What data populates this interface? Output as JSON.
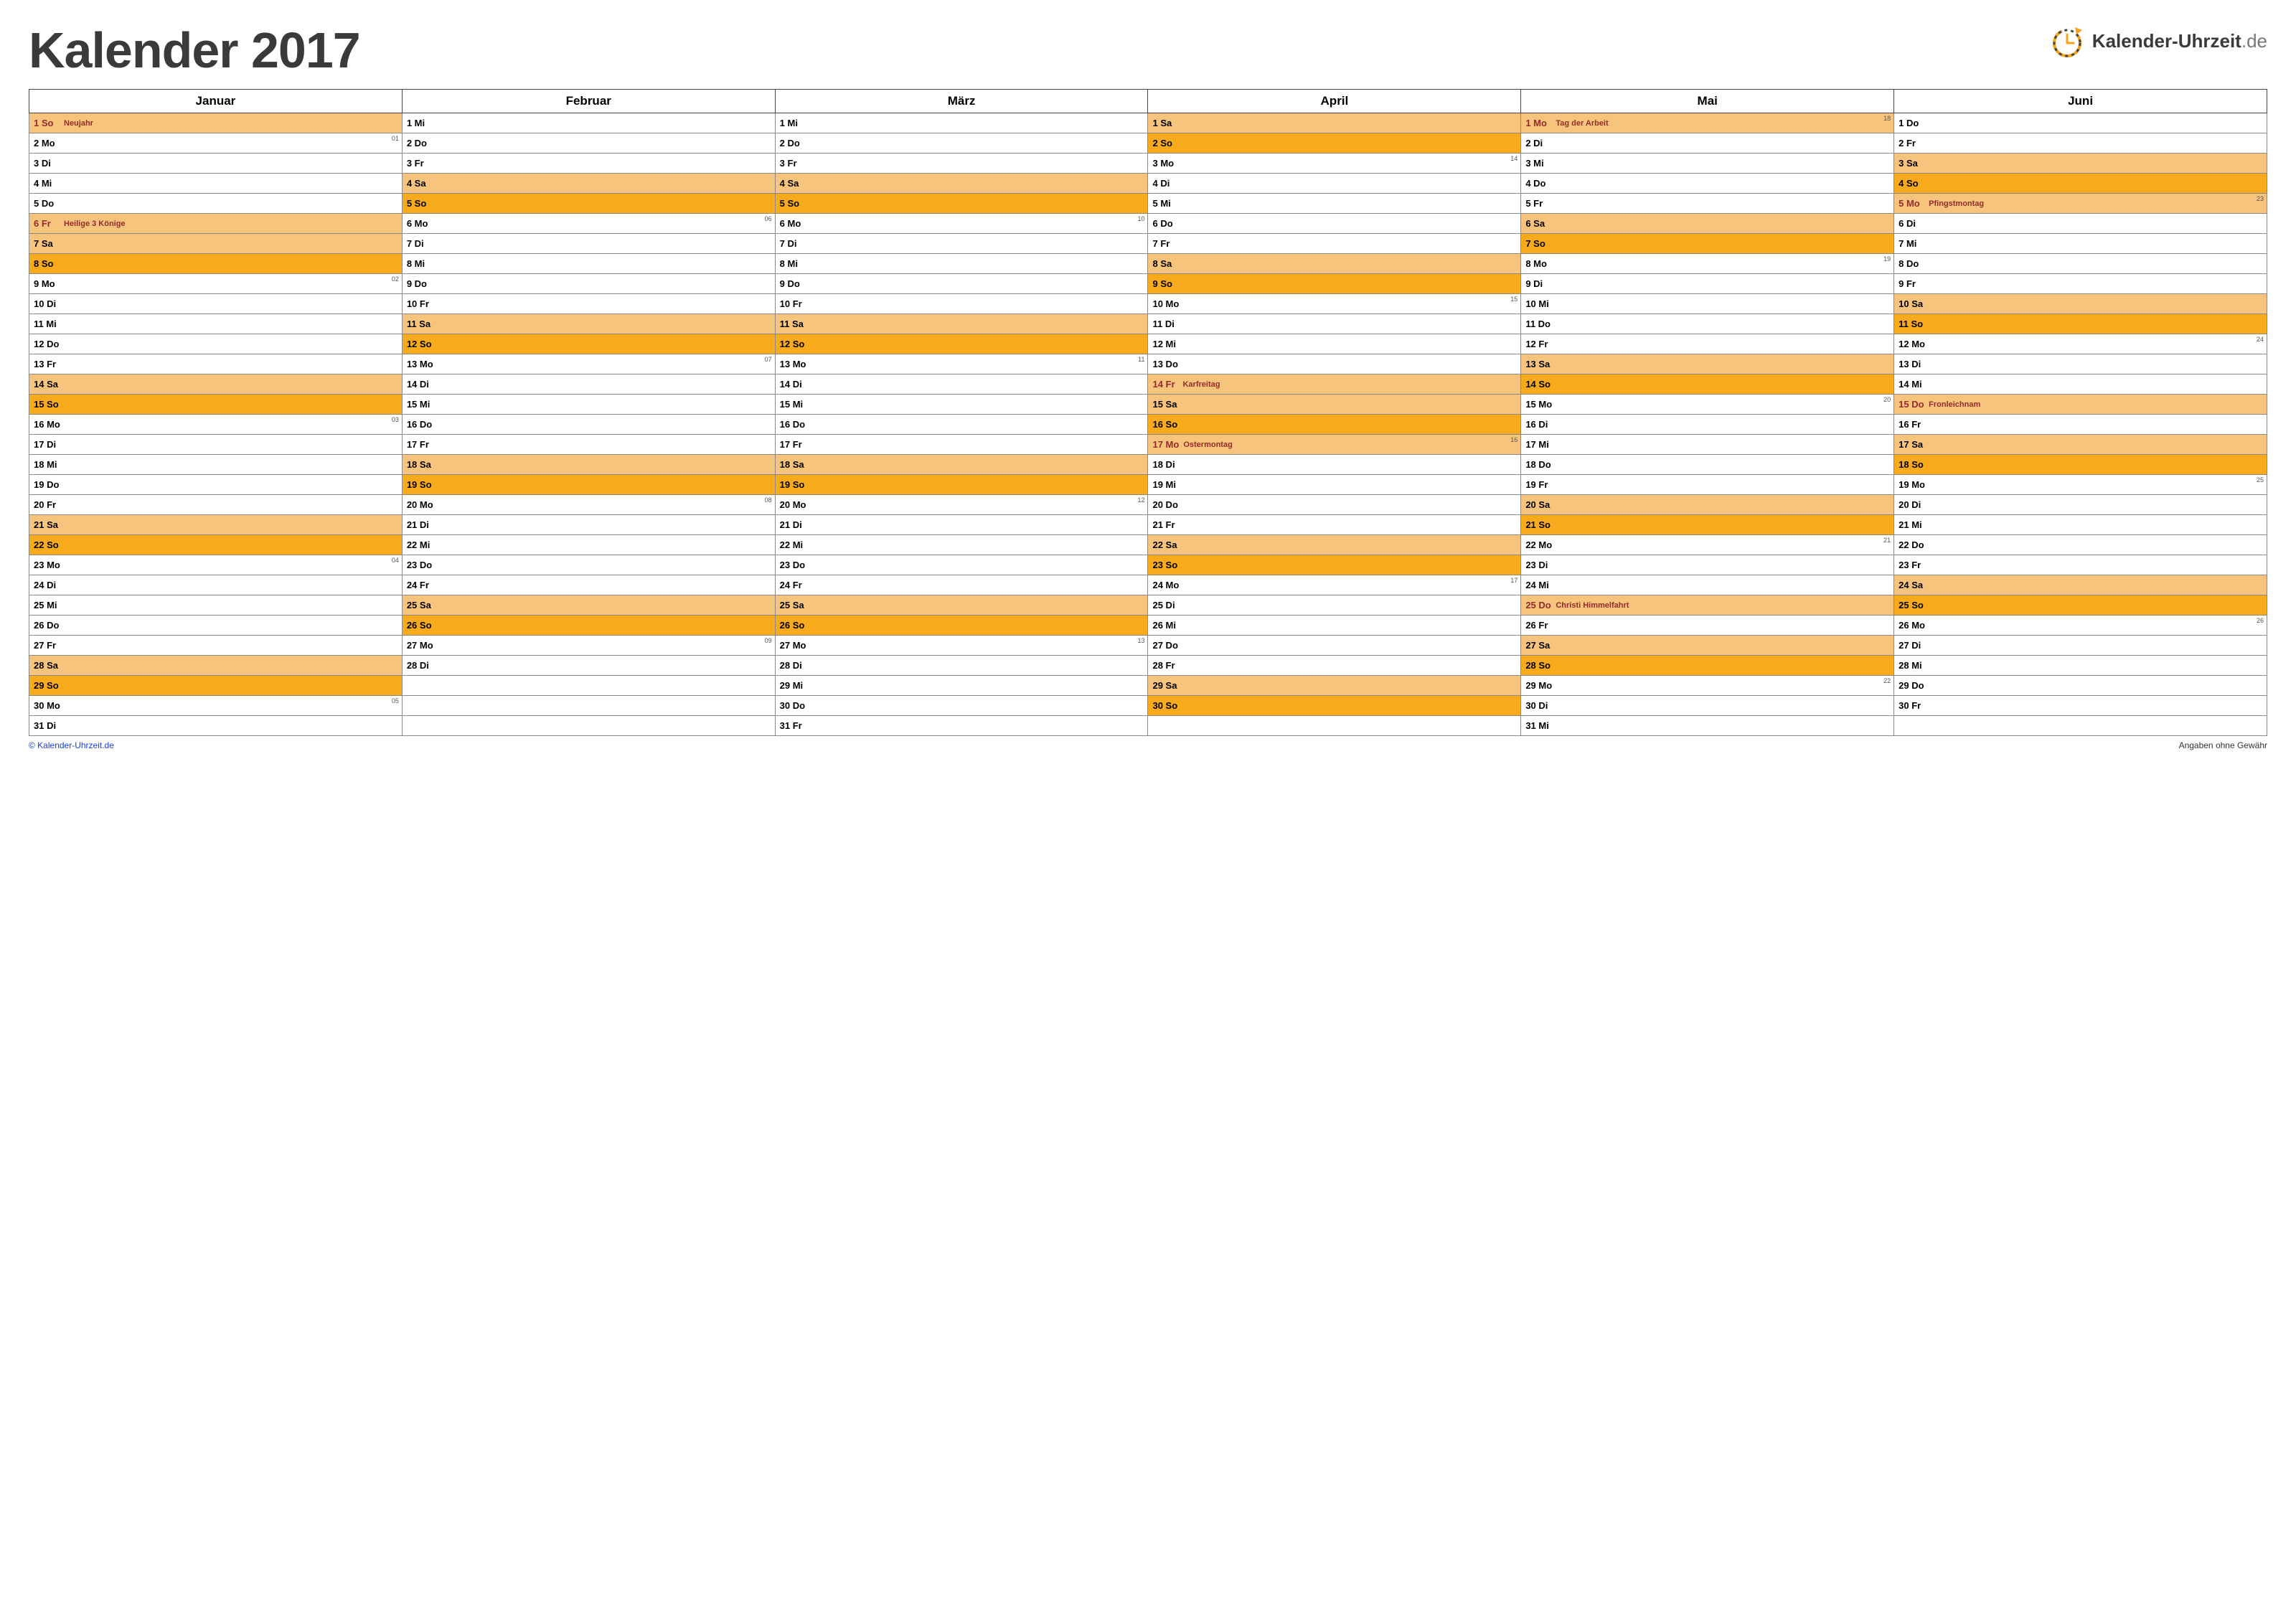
{
  "title": "Kalender 2017",
  "logo_text_a": "Kalender-Uhrzeit",
  "logo_text_b": ".de",
  "footer_left": "© Kalender-Uhrzeit.de",
  "footer_right": "Angaben ohne Gewähr",
  "months": [
    "Januar",
    "Februar",
    "März",
    "April",
    "Mai",
    "Juni"
  ],
  "weekday_short": [
    "Mo",
    "Di",
    "Mi",
    "Do",
    "Fr",
    "Sa",
    "So"
  ],
  "start_dow": [
    6,
    2,
    2,
    5,
    0,
    3
  ],
  "days_in_month": [
    31,
    28,
    31,
    30,
    31,
    30
  ],
  "holidays": {
    "0": {
      "1": "Neujahr",
      "6": "Heilige 3 Könige"
    },
    "3": {
      "14": "Karfreitag",
      "17": "Ostermontag"
    },
    "4": {
      "1": "Tag der Arbeit",
      "25": "Christi Himmelfahrt"
    },
    "5": {
      "5": "Pfingstmontag",
      "15": "Fronleichnam"
    }
  },
  "week_numbers": {
    "0": {
      "2": "01",
      "9": "02",
      "16": "03",
      "23": "04",
      "30": "05"
    },
    "1": {
      "6": "06",
      "13": "07",
      "20": "08",
      "27": "09"
    },
    "2": {
      "6": "10",
      "13": "11",
      "20": "12",
      "27": "13"
    },
    "3": {
      "3": "14",
      "10": "15",
      "17": "16",
      "24": "17"
    },
    "4": {
      "1": "18",
      "8": "19",
      "15": "20",
      "22": "21",
      "29": "22"
    },
    "5": {
      "5": "23",
      "12": "24",
      "19": "25",
      "26": "26"
    }
  }
}
